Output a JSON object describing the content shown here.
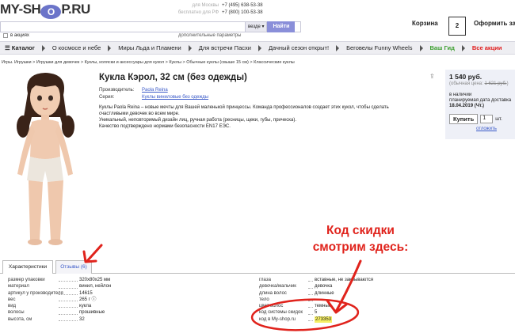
{
  "header": {
    "logo_left": "MY-SH",
    "logo_ball": "O",
    "logo_right": "P.RU",
    "phones": [
      {
        "label": "для Москвы",
        "number": "+7 (495) 638-53-38"
      },
      {
        "label": "бесплатно для РФ",
        "number": "+7 (800) 100-53-38"
      }
    ],
    "search_where": "везде ▾",
    "search_button": "Найти",
    "stocks_label": "в акциях",
    "advanced_label": "дополнительные параметры",
    "cart_label": "Корзина",
    "cart_count": "2",
    "checkout_label": "Оформить зак"
  },
  "nav": {
    "catalog": "☰ Каталог",
    "items": [
      "О космосе и небе",
      "Миры Льда и Пламени",
      "Для встречи Пасхи",
      "Дачный сезон открыт!",
      "Беговелы Funny Wheels"
    ],
    "green_item": "Ваш Гид",
    "red_item": "Все акции"
  },
  "breadcrumb": "Игры. Игрушки  >  Игрушки для девочек  >  Куклы, коляски и аксессуары для кукол  >  Куклы  >  Обычные куклы (свыше 15 см)  >  Классические куклы",
  "product": {
    "title": "Кукла Кэрол, 32 см (без одежды)",
    "manufacturer_label": "Производитель:",
    "manufacturer": "Paola Reina",
    "series_label": "Серия:",
    "series": "Куклы виниловые без одежды",
    "desc": [
      "Куклы Paola Reina – новые мечты для Вашей маленькой принцессы. Команда профессионалов создает этих кукол, чтобы сделать",
      "счастливыми девочек во всем мире.",
      "Уникальный, неповторимый дизайн лиц, ручная работа (ресницы, щеки, губы, прическа).",
      "Качество подтверждено нормами безопасности EN17 ЕЭС."
    ]
  },
  "pricebox": {
    "price": "1 540 руб.",
    "old_prefix": "(обычная цена: ",
    "old_price": "1 621 руб.",
    "old_suffix": ")",
    "stock_1": "в наличии",
    "stock_2": "планируемая дата доставка",
    "stock_3": "18.04.2019 (Чт.)",
    "buy": "Купить",
    "qty": "1",
    "unit": "шт.",
    "defer": "отложить"
  },
  "annotation": {
    "line1": "Код скидки",
    "line2": "смотрим здесь:"
  },
  "tabs": {
    "characteristics": "Характеристики",
    "reviews": "Отзывы (6)"
  },
  "chars_left": [
    {
      "k": "размер упаковки",
      "v": "320x80x25 мм"
    },
    {
      "k": "материал",
      "v": "винил, нейлон"
    },
    {
      "k": "артикул у производителя",
      "v": "14615"
    },
    {
      "k": "вес",
      "v": "265 г ⓘ"
    },
    {
      "k": "вид",
      "v": "кукла"
    },
    {
      "k": "волосы",
      "v": "прошивные"
    },
    {
      "k": "высота, см",
      "v": "32"
    }
  ],
  "chars_right": [
    {
      "k": "глаза",
      "v": "вставные, не закрываются"
    },
    {
      "k": "девочка/мальчик",
      "v": "девочка"
    },
    {
      "k": "длина волос",
      "v": "длинные"
    },
    {
      "k": "тело",
      "v": ""
    },
    {
      "k": "цвет волос",
      "v": "темные"
    },
    {
      "k": "код системы скидок",
      "v": "5"
    },
    {
      "k": "код в My-shop.ru",
      "v": "273353"
    }
  ],
  "colors": {
    "accent": "#8a8fd9",
    "annotation_red": "#e0231c",
    "highlight": "#f6ef63"
  }
}
